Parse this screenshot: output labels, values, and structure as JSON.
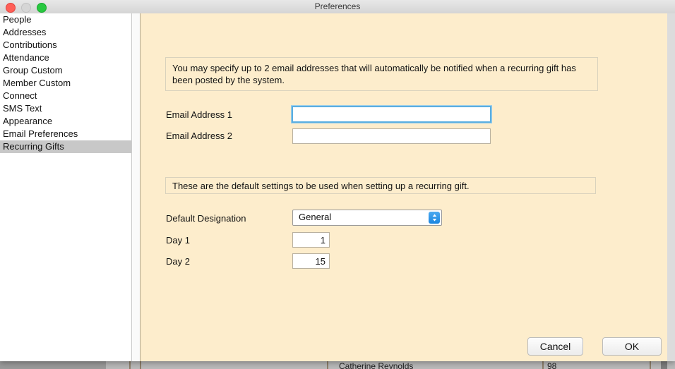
{
  "window": {
    "title": "Preferences",
    "traffic_lights": [
      "close",
      "minimize",
      "zoom"
    ]
  },
  "sidebar": {
    "items": [
      {
        "label": "People",
        "selected": false
      },
      {
        "label": "Addresses",
        "selected": false
      },
      {
        "label": "Contributions",
        "selected": false
      },
      {
        "label": "Attendance",
        "selected": false
      },
      {
        "label": "Group Custom",
        "selected": false
      },
      {
        "label": "Member Custom",
        "selected": false
      },
      {
        "label": "Connect",
        "selected": false
      },
      {
        "label": "SMS Text",
        "selected": false
      },
      {
        "label": "Appearance",
        "selected": false
      },
      {
        "label": "Email Preferences",
        "selected": false
      },
      {
        "label": "Recurring Gifts",
        "selected": true
      }
    ]
  },
  "panel": {
    "email_banner": "You may specify up to 2 email addresses that will automatically be notified when a recurring gift has been posted by the system.",
    "defaults_banner": "These are the default settings to be used when setting up a recurring gift.",
    "fields": {
      "email1": {
        "label": "Email Address 1",
        "value": "",
        "placeholder": ""
      },
      "email2": {
        "label": "Email Address 2",
        "value": "",
        "placeholder": ""
      },
      "designation": {
        "label": "Default Designation",
        "value": "General",
        "options": [
          "General"
        ]
      },
      "day1": {
        "label": "Day 1",
        "value": "1"
      },
      "day2": {
        "label": "Day 2",
        "value": "15"
      }
    }
  },
  "buttons": {
    "cancel": "Cancel",
    "ok": "OK"
  },
  "background": {
    "row_name": "Catherine Reynolds",
    "row_value": "98",
    "ghost_chars": [
      "_",
      "c",
      "n",
      "n"
    ]
  },
  "colors": {
    "panel_background": "#fdedcc",
    "banner_border": "#d9d2bd",
    "selection": "#c8c8c8",
    "focus_ring": "#5aaee0",
    "accent": "#1b86e0",
    "titlebar": "#e0e0e0",
    "close": "#ff5f57",
    "minimize": "#d6d6d6",
    "zoom": "#28c840"
  }
}
